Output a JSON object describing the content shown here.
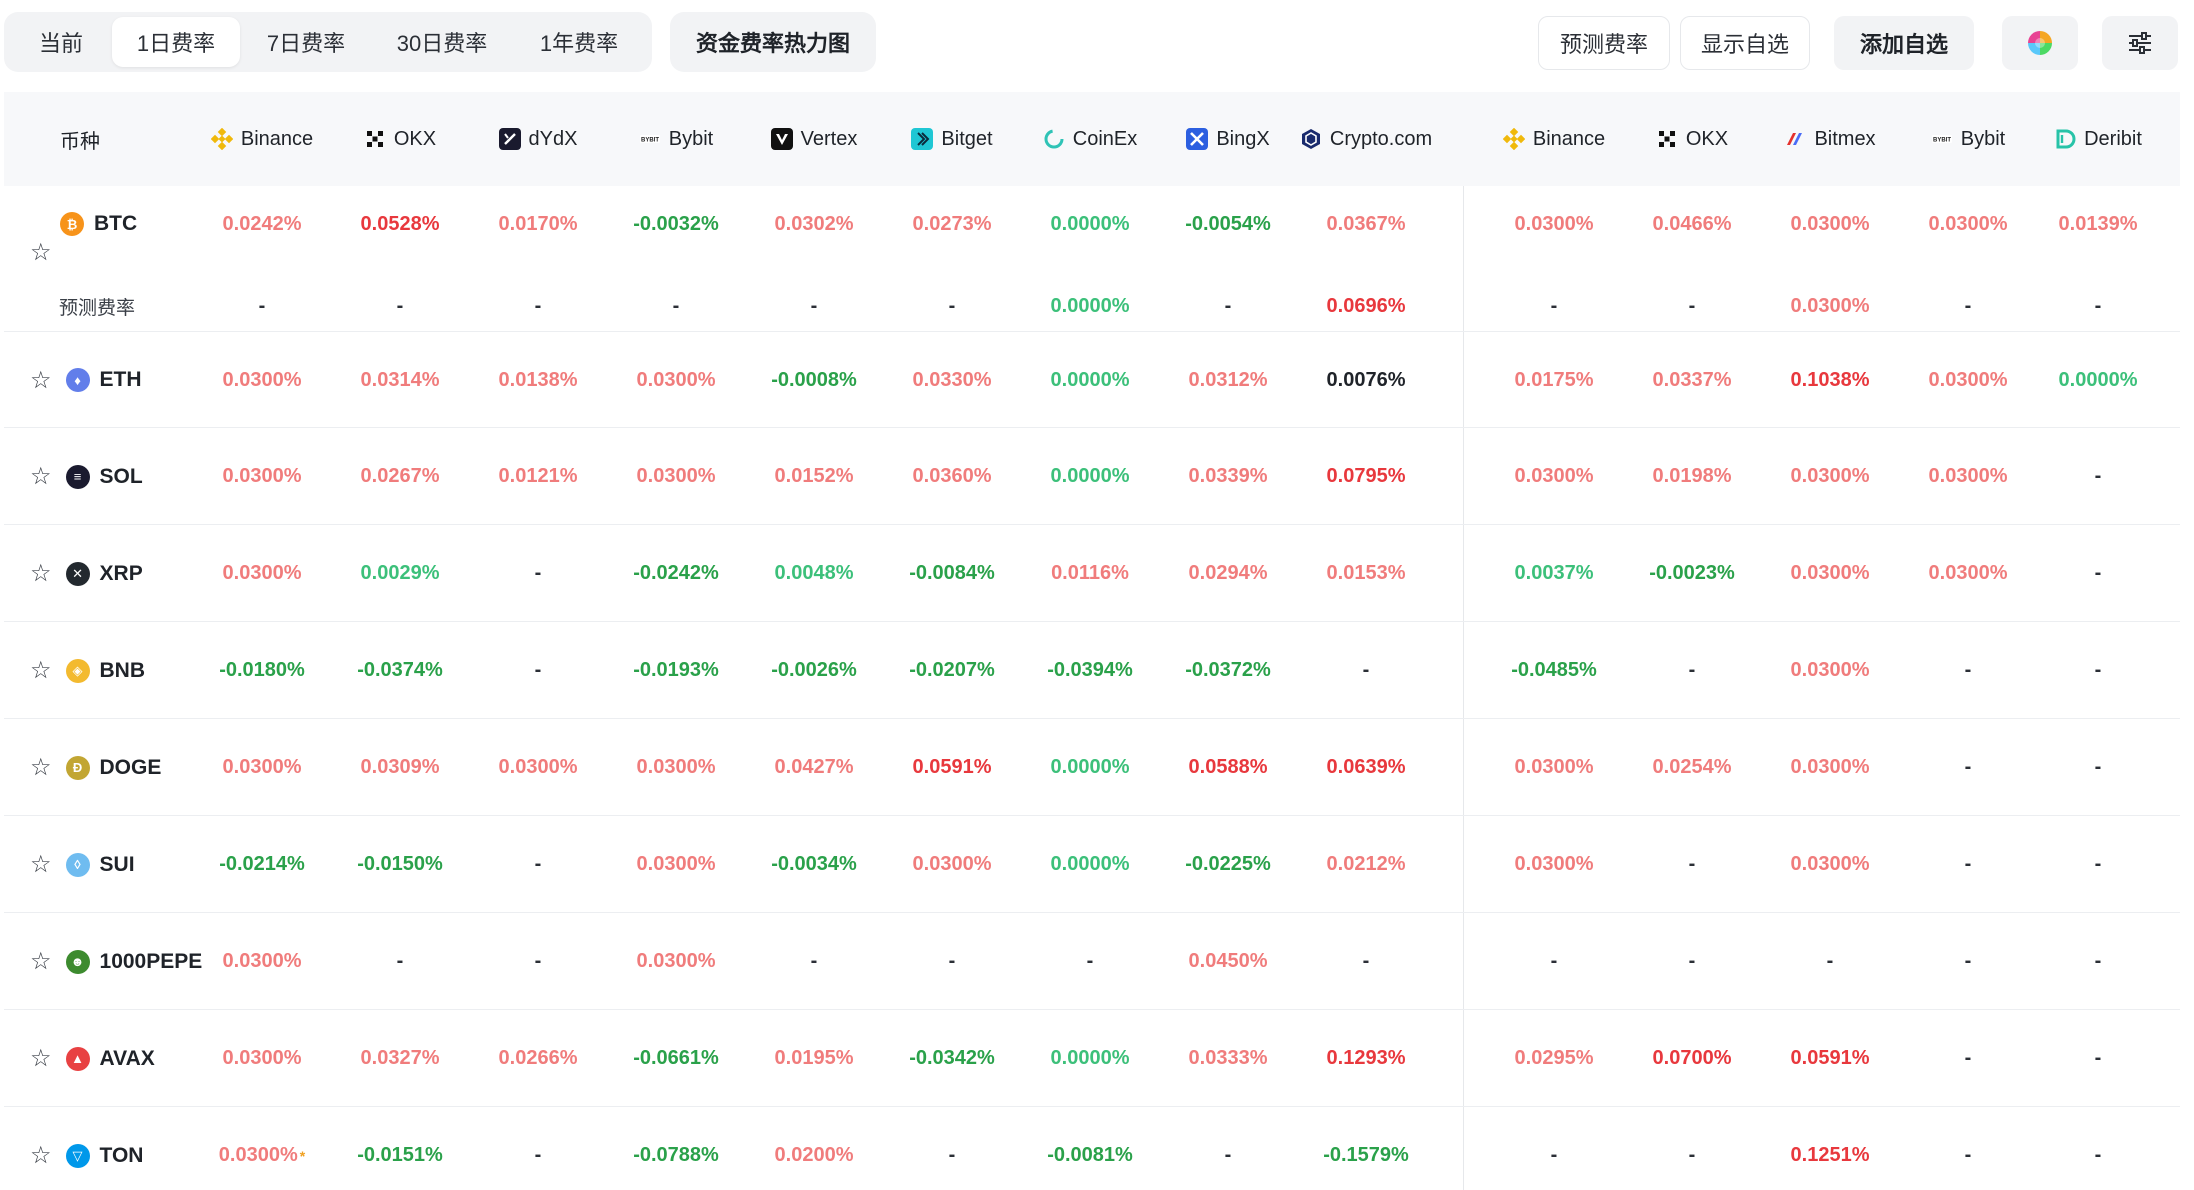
{
  "tabs": [
    {
      "label": "当前",
      "active": false
    },
    {
      "label": "1日费率",
      "active": true
    },
    {
      "label": "7日费率",
      "active": false
    },
    {
      "label": "30日费率",
      "active": false
    },
    {
      "label": "1年费率",
      "active": false
    }
  ],
  "heatmap_label": "资金费率热力图",
  "toolbar_right": {
    "predict": "预测费率",
    "show_fav": "显示自选",
    "add_fav": "添加自选"
  },
  "table": {
    "coin_header": "币种",
    "predicted_label": "预测费率",
    "exchanges": [
      {
        "name": "Binance",
        "icon": "binance-icon"
      },
      {
        "name": "OKX",
        "icon": "okx-icon"
      },
      {
        "name": "dYdX",
        "icon": "dydx-icon"
      },
      {
        "name": "Bybit",
        "icon": "bybit-icon"
      },
      {
        "name": "Vertex",
        "icon": "vertex-icon"
      },
      {
        "name": "Bitget",
        "icon": "bitget-icon"
      },
      {
        "name": "CoinEx",
        "icon": "coinex-icon"
      },
      {
        "name": "BingX",
        "icon": "bingx-icon"
      },
      {
        "name": "Crypto.com",
        "icon": "cryptocom-icon"
      },
      {
        "name": "Binance",
        "icon": "binance-icon"
      },
      {
        "name": "OKX",
        "icon": "okx-icon"
      },
      {
        "name": "Bitmex",
        "icon": "bitmex-icon"
      },
      {
        "name": "Bybit",
        "icon": "bybit-icon"
      },
      {
        "name": "Deribit",
        "icon": "deribit-icon"
      }
    ],
    "rows": [
      {
        "coin": "BTC",
        "icon": "btc-icon",
        "color": "#f7931a",
        "rates": [
          "0.0242%",
          "0.0528%",
          "0.0170%",
          "-0.0032%",
          "0.0302%",
          "0.0273%",
          "0.0000%",
          "-0.0054%",
          "0.0367%",
          "0.0300%",
          "0.0466%",
          "0.0300%",
          "0.0300%",
          "0.0139%"
        ],
        "tones": [
          "pos",
          "strong",
          "pos",
          "neg",
          "pos",
          "pos",
          "zero",
          "neg",
          "pos",
          "pos",
          "pos",
          "pos",
          "pos",
          "pos"
        ],
        "predicted": [
          "-",
          "-",
          "-",
          "-",
          "-",
          "-",
          "0.0000%",
          "-",
          "0.0696%",
          "-",
          "-",
          "0.0300%",
          "-",
          "-"
        ],
        "predicted_tones": [
          "dash",
          "dash",
          "dash",
          "dash",
          "dash",
          "dash",
          "zero",
          "dash",
          "strong",
          "dash",
          "dash",
          "pos",
          "dash",
          "dash"
        ]
      },
      {
        "coin": "ETH",
        "icon": "eth-icon",
        "color": "#627eea",
        "rates": [
          "0.0300%",
          "0.0314%",
          "0.0138%",
          "0.0300%",
          "-0.0008%",
          "0.0330%",
          "0.0000%",
          "0.0312%",
          "0.0076%",
          "0.0175%",
          "0.0337%",
          "0.1038%",
          "0.0300%",
          "0.0000%"
        ],
        "tones": [
          "pos",
          "pos",
          "pos",
          "pos",
          "neg",
          "pos",
          "zero",
          "pos",
          "neutral",
          "pos",
          "pos",
          "strong",
          "pos",
          "zero"
        ]
      },
      {
        "coin": "SOL",
        "icon": "sol-icon",
        "color": "#1b1b2f",
        "rates": [
          "0.0300%",
          "0.0267%",
          "0.0121%",
          "0.0300%",
          "0.0152%",
          "0.0360%",
          "0.0000%",
          "0.0339%",
          "0.0795%",
          "0.0300%",
          "0.0198%",
          "0.0300%",
          "0.0300%",
          "-"
        ],
        "tones": [
          "pos",
          "pos",
          "pos",
          "pos",
          "pos",
          "pos",
          "zero",
          "pos",
          "strong",
          "pos",
          "pos",
          "pos",
          "pos",
          "dash"
        ]
      },
      {
        "coin": "XRP",
        "icon": "xrp-icon",
        "color": "#23292f",
        "rates": [
          "0.0300%",
          "0.0029%",
          "-",
          "-0.0242%",
          "0.0048%",
          "-0.0084%",
          "0.0116%",
          "0.0294%",
          "0.0153%",
          "0.0037%",
          "-0.0023%",
          "0.0300%",
          "0.0300%",
          "-"
        ],
        "tones": [
          "pos",
          "zero",
          "dash",
          "neg",
          "zero",
          "neg",
          "pos",
          "pos",
          "pos",
          "zero",
          "neg",
          "pos",
          "pos",
          "dash"
        ]
      },
      {
        "coin": "BNB",
        "icon": "bnb-icon",
        "color": "#f3ba2f",
        "rates": [
          "-0.0180%",
          "-0.0374%",
          "-",
          "-0.0193%",
          "-0.0026%",
          "-0.0207%",
          "-0.0394%",
          "-0.0372%",
          "-",
          "-0.0485%",
          "-",
          "0.0300%",
          "-",
          "-"
        ],
        "tones": [
          "neg",
          "neg",
          "dash",
          "neg",
          "neg",
          "neg",
          "neg",
          "neg",
          "dash",
          "neg",
          "dash",
          "pos",
          "dash",
          "dash"
        ]
      },
      {
        "coin": "DOGE",
        "icon": "doge-icon",
        "color": "#c2a633",
        "rates": [
          "0.0300%",
          "0.0309%",
          "0.0300%",
          "0.0300%",
          "0.0427%",
          "0.0591%",
          "0.0000%",
          "0.0588%",
          "0.0639%",
          "0.0300%",
          "0.0254%",
          "0.0300%",
          "-",
          "-"
        ],
        "tones": [
          "pos",
          "pos",
          "pos",
          "pos",
          "pos",
          "strong",
          "zero",
          "strong",
          "strong",
          "pos",
          "pos",
          "pos",
          "dash",
          "dash"
        ]
      },
      {
        "coin": "SUI",
        "icon": "sui-icon",
        "color": "#6fbcf0",
        "rates": [
          "-0.0214%",
          "-0.0150%",
          "-",
          "0.0300%",
          "-0.0034%",
          "0.0300%",
          "0.0000%",
          "-0.0225%",
          "0.0212%",
          "0.0300%",
          "-",
          "0.0300%",
          "-",
          "-"
        ],
        "tones": [
          "neg",
          "neg",
          "dash",
          "pos",
          "neg",
          "pos",
          "zero",
          "neg",
          "pos",
          "pos",
          "dash",
          "pos",
          "dash",
          "dash"
        ]
      },
      {
        "coin": "1000PEPE",
        "icon": "pepe-icon",
        "color": "#3d8b2f",
        "rates": [
          "0.0300%",
          "-",
          "-",
          "0.0300%",
          "-",
          "-",
          "-",
          "0.0450%",
          "-",
          "-",
          "-",
          "-",
          "-",
          "-"
        ],
        "tones": [
          "pos",
          "dash",
          "dash",
          "pos",
          "dash",
          "dash",
          "dash",
          "pos",
          "dash",
          "dash",
          "dash",
          "dash",
          "dash",
          "dash"
        ]
      },
      {
        "coin": "AVAX",
        "icon": "avax-icon",
        "color": "#e84142",
        "rates": [
          "0.0300%",
          "0.0327%",
          "0.0266%",
          "-0.0661%",
          "0.0195%",
          "-0.0342%",
          "0.0000%",
          "0.0333%",
          "0.1293%",
          "0.0295%",
          "0.0700%",
          "0.0591%",
          "-",
          "-"
        ],
        "tones": [
          "pos",
          "pos",
          "pos",
          "neg",
          "pos",
          "neg",
          "zero",
          "pos",
          "strong",
          "pos",
          "strong",
          "strong",
          "dash",
          "dash"
        ]
      },
      {
        "coin": "TON",
        "icon": "ton-icon",
        "color": "#0098ea",
        "rates": [
          "0.0300%",
          "-0.0151%",
          "-",
          "-0.0788%",
          "0.0200%",
          "-",
          "-0.0081%",
          "-",
          "-0.1579%",
          "-",
          "-",
          "0.1251%",
          "-",
          "-"
        ],
        "tones": [
          "pos",
          "neg",
          "dash",
          "neg",
          "pos",
          "dash",
          "neg",
          "dash",
          "neg",
          "dash",
          "dash",
          "strong",
          "dash",
          "dash"
        ],
        "note_marker": "*"
      }
    ]
  }
}
